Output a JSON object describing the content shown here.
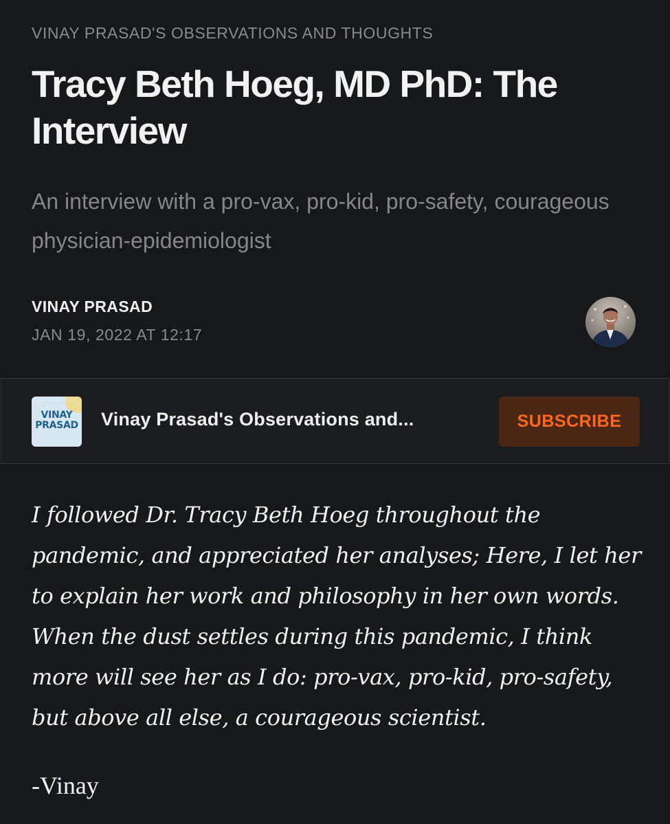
{
  "header": {
    "publication_name": "VINAY PRASAD'S OBSERVATIONS AND THOUGHTS",
    "title": "Tracy Beth Hoeg, MD PhD: The Interview",
    "subtitle": "An interview with a pro-vax, pro-kid, pro-safety, courageous physician-epidemiologist"
  },
  "byline": {
    "author": "VINAY PRASAD",
    "date": "JAN 19, 2022 AT 12:17",
    "avatar_icon": "author-avatar"
  },
  "embed": {
    "logo_text": "VINAY\nPRASAD",
    "publication_title": "Vinay Prasad's Observations and...",
    "subscribe_label": "SUBSCRIBE",
    "accent_color": "#ff6719"
  },
  "body": {
    "intro": "I followed Dr. Tracy Beth Hoeg throughout the pandemic, and appreciated her analyses; Here, I let her to explain her work and philosophy in her own words. When the dust settles during this pandemic, I think more will see her as I do: pro-vax, pro-kid, pro-safety, but above all else, a courageous scientist.",
    "signature": "-Vinay"
  },
  "colors": {
    "background": "#17181a",
    "muted_text": "#8a8a8d",
    "primary_text": "#f2f2f2"
  }
}
